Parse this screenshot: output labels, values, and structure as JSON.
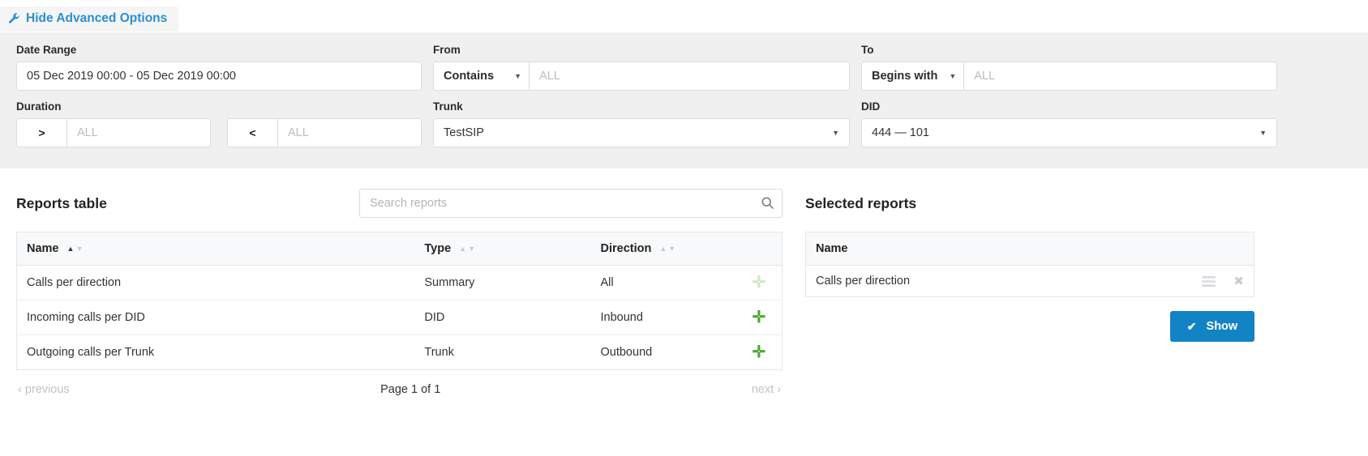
{
  "topbar": {
    "advanced_toggle_label": "Hide Advanced Options",
    "icon": "wrench-icon"
  },
  "filters": {
    "date_range": {
      "label": "Date Range",
      "value": "05 Dec 2019 00:00 - 05 Dec 2019 00:00"
    },
    "from": {
      "label": "From",
      "operator": "Contains",
      "placeholder": "ALL",
      "value": ""
    },
    "to": {
      "label": "To",
      "operator": "Begins with",
      "placeholder": "ALL",
      "value": ""
    },
    "duration": {
      "label": "Duration",
      "min_operator": ">",
      "min_placeholder": "ALL",
      "min_value": "",
      "max_operator": "<",
      "max_placeholder": "ALL",
      "max_value": ""
    },
    "trunk": {
      "label": "Trunk",
      "value": "TestSIP"
    },
    "did": {
      "label": "DID",
      "value": "444  —  101"
    }
  },
  "reports": {
    "title": "Reports table",
    "search": {
      "placeholder": "Search reports",
      "value": "",
      "icon": "search-icon"
    },
    "columns": [
      "Name",
      "Type",
      "Direction"
    ],
    "sort": {
      "column": "Name",
      "direction": "asc"
    },
    "rows": [
      {
        "name": "Calls per direction",
        "type": "Summary",
        "direction": "All",
        "add_enabled": false
      },
      {
        "name": "Incoming calls per DID",
        "type": "DID",
        "direction": "Inbound",
        "add_enabled": true
      },
      {
        "name": "Outgoing calls per Trunk",
        "type": "Trunk",
        "direction": "Outbound",
        "add_enabled": true
      }
    ],
    "pager": {
      "previous": "previous",
      "page_info": "Page 1 of 1",
      "next": "next"
    }
  },
  "selected": {
    "title": "Selected reports",
    "column": "Name",
    "rows": [
      {
        "name": "Calls per direction"
      }
    ],
    "show_button": "Show"
  },
  "colors": {
    "accent": "#1283c4",
    "link": "#2a8fd0",
    "add": "#4aa832",
    "panel": "#f0f0f0"
  }
}
